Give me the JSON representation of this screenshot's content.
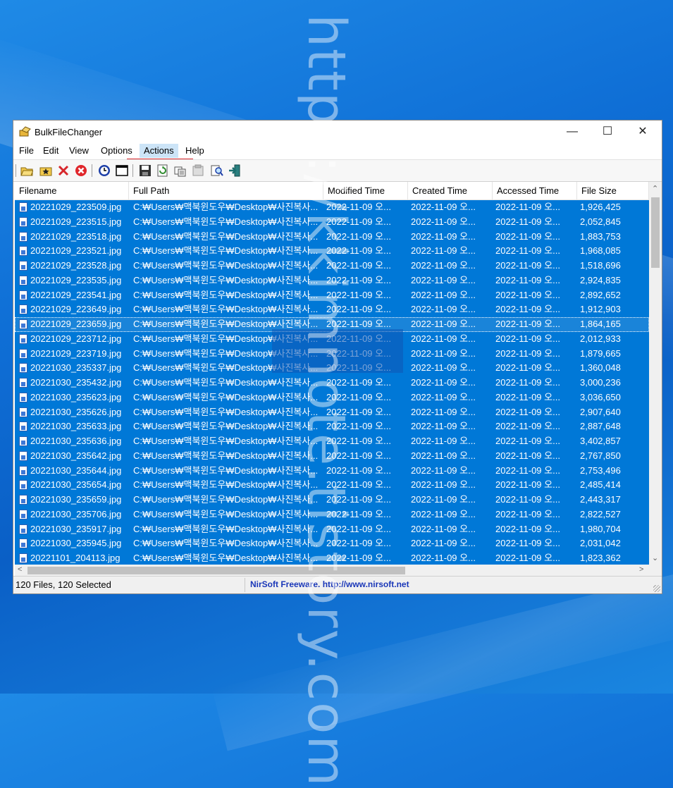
{
  "window": {
    "title": "BulkFileChanger"
  },
  "menu": [
    "File",
    "Edit",
    "View",
    "Options",
    "Actions",
    "Help"
  ],
  "toolbar_icons": [
    "open-folder-icon",
    "star-folder-icon",
    "remove-icon",
    "clear-icon",
    "clock-icon",
    "window-icon",
    "save-icon",
    "refresh-icon",
    "copy-icon",
    "properties-icon",
    "find-icon",
    "exit-icon"
  ],
  "columns": [
    "Filename",
    "Full Path",
    "Modified Time",
    "Created Time",
    "Accessed Time",
    "File Size"
  ],
  "rows": [
    {
      "name": "20221029_223509.jpg",
      "path": "C:₩Users₩맥북윈도우₩Desktop₩사진복사...",
      "mod": "2022-11-09 오...",
      "cre": "2022-11-09 오...",
      "acc": "2022-11-09 오...",
      "size": "1,926,425"
    },
    {
      "name": "20221029_223515.jpg",
      "path": "C:₩Users₩맥북윈도우₩Desktop₩사진복사...",
      "mod": "2022-11-09 오...",
      "cre": "2022-11-09 오...",
      "acc": "2022-11-09 오...",
      "size": "2,052,845"
    },
    {
      "name": "20221029_223518.jpg",
      "path": "C:₩Users₩맥북윈도우₩Desktop₩사진복사...",
      "mod": "2022-11-09 오...",
      "cre": "2022-11-09 오...",
      "acc": "2022-11-09 오...",
      "size": "1,883,753"
    },
    {
      "name": "20221029_223521.jpg",
      "path": "C:₩Users₩맥북윈도우₩Desktop₩사진복사...",
      "mod": "2022-11-09 오...",
      "cre": "2022-11-09 오...",
      "acc": "2022-11-09 오...",
      "size": "1,968,085"
    },
    {
      "name": "20221029_223528.jpg",
      "path": "C:₩Users₩맥북윈도우₩Desktop₩사진복사...",
      "mod": "2022-11-09 오...",
      "cre": "2022-11-09 오...",
      "acc": "2022-11-09 오...",
      "size": "1,518,696"
    },
    {
      "name": "20221029_223535.jpg",
      "path": "C:₩Users₩맥북윈도우₩Desktop₩사진복사...",
      "mod": "2022-11-09 오...",
      "cre": "2022-11-09 오...",
      "acc": "2022-11-09 오...",
      "size": "2,924,835"
    },
    {
      "name": "20221029_223541.jpg",
      "path": "C:₩Users₩맥북윈도우₩Desktop₩사진복사...",
      "mod": "2022-11-09 오...",
      "cre": "2022-11-09 오...",
      "acc": "2022-11-09 오...",
      "size": "2,892,652"
    },
    {
      "name": "20221029_223649.jpg",
      "path": "C:₩Users₩맥북윈도우₩Desktop₩사진복사...",
      "mod": "2022-11-09 오...",
      "cre": "2022-11-09 오...",
      "acc": "2022-11-09 오...",
      "size": "1,912,903"
    },
    {
      "name": "20221029_223659.jpg",
      "path": "C:₩Users₩맥북윈도우₩Desktop₩사진복사...",
      "mod": "2022-11-09 오...",
      "cre": "2022-11-09 오...",
      "acc": "2022-11-09 오...",
      "size": "1,864,165"
    },
    {
      "name": "20221029_223712.jpg",
      "path": "C:₩Users₩맥북윈도우₩Desktop₩사진복사...",
      "mod": "2022-11-09 오...",
      "cre": "2022-11-09 오...",
      "acc": "2022-11-09 오...",
      "size": "2,012,933"
    },
    {
      "name": "20221029_223719.jpg",
      "path": "C:₩Users₩맥북윈도우₩Desktop₩사진복사...",
      "mod": "2022-11-09 오...",
      "cre": "2022-11-09 오...",
      "acc": "2022-11-09 오...",
      "size": "1,879,665"
    },
    {
      "name": "20221030_235337.jpg",
      "path": "C:₩Users₩맥북윈도우₩Desktop₩사진복사...",
      "mod": "2022-11-09 오...",
      "cre": "2022-11-09 오...",
      "acc": "2022-11-09 오...",
      "size": "1,360,048"
    },
    {
      "name": "20221030_235432.jpg",
      "path": "C:₩Users₩맥북윈도우₩Desktop₩사진복사...",
      "mod": "2022-11-09 오...",
      "cre": "2022-11-09 오...",
      "acc": "2022-11-09 오...",
      "size": "3,000,236"
    },
    {
      "name": "20221030_235623.jpg",
      "path": "C:₩Users₩맥북윈도우₩Desktop₩사진복사...",
      "mod": "2022-11-09 오...",
      "cre": "2022-11-09 오...",
      "acc": "2022-11-09 오...",
      "size": "3,036,650"
    },
    {
      "name": "20221030_235626.jpg",
      "path": "C:₩Users₩맥북윈도우₩Desktop₩사진복사...",
      "mod": "2022-11-09 오...",
      "cre": "2022-11-09 오...",
      "acc": "2022-11-09 오...",
      "size": "2,907,640"
    },
    {
      "name": "20221030_235633.jpg",
      "path": "C:₩Users₩맥북윈도우₩Desktop₩사진복사...",
      "mod": "2022-11-09 오...",
      "cre": "2022-11-09 오...",
      "acc": "2022-11-09 오...",
      "size": "2,887,648"
    },
    {
      "name": "20221030_235636.jpg",
      "path": "C:₩Users₩맥북윈도우₩Desktop₩사진복사...",
      "mod": "2022-11-09 오...",
      "cre": "2022-11-09 오...",
      "acc": "2022-11-09 오...",
      "size": "3,402,857"
    },
    {
      "name": "20221030_235642.jpg",
      "path": "C:₩Users₩맥북윈도우₩Desktop₩사진복사...",
      "mod": "2022-11-09 오...",
      "cre": "2022-11-09 오...",
      "acc": "2022-11-09 오...",
      "size": "2,767,850"
    },
    {
      "name": "20221030_235644.jpg",
      "path": "C:₩Users₩맥북윈도우₩Desktop₩사진복사...",
      "mod": "2022-11-09 오...",
      "cre": "2022-11-09 오...",
      "acc": "2022-11-09 오...",
      "size": "2,753,496"
    },
    {
      "name": "20221030_235654.jpg",
      "path": "C:₩Users₩맥북윈도우₩Desktop₩사진복사...",
      "mod": "2022-11-09 오...",
      "cre": "2022-11-09 오...",
      "acc": "2022-11-09 오...",
      "size": "2,485,414"
    },
    {
      "name": "20221030_235659.jpg",
      "path": "C:₩Users₩맥북윈도우₩Desktop₩사진복사...",
      "mod": "2022-11-09 오...",
      "cre": "2022-11-09 오...",
      "acc": "2022-11-09 오...",
      "size": "2,443,317"
    },
    {
      "name": "20221030_235706.jpg",
      "path": "C:₩Users₩맥북윈도우₩Desktop₩사진복사...",
      "mod": "2022-11-09 오...",
      "cre": "2022-11-09 오...",
      "acc": "2022-11-09 오...",
      "size": "2,822,527"
    },
    {
      "name": "20221030_235917.jpg",
      "path": "C:₩Users₩맥북윈도우₩Desktop₩사진복사...",
      "mod": "2022-11-09 오...",
      "cre": "2022-11-09 오...",
      "acc": "2022-11-09 오...",
      "size": "1,980,704"
    },
    {
      "name": "20221030_235945.jpg",
      "path": "C:₩Users₩맥북윈도우₩Desktop₩사진복사...",
      "mod": "2022-11-09 오...",
      "cre": "2022-11-09 오...",
      "acc": "2022-11-09 오...",
      "size": "2,031,042"
    },
    {
      "name": "20221101_204113.jpg",
      "path": "C:₩Users₩맥북윈도우₩Desktop₩사진복사...",
      "mod": "2022-11-09 오...",
      "cre": "2022-11-09 오...",
      "acc": "2022-11-09 오...",
      "size": "1,823,362"
    }
  ],
  "status": {
    "left": "120 Files, 120 Selected",
    "right": "NirSoft Freeware.  http://www.nirsoft.net"
  },
  "watermark": "https://kkimnote.tistory.com",
  "colors": {
    "selection": "#0078d7",
    "highlight": "#d7262b"
  }
}
